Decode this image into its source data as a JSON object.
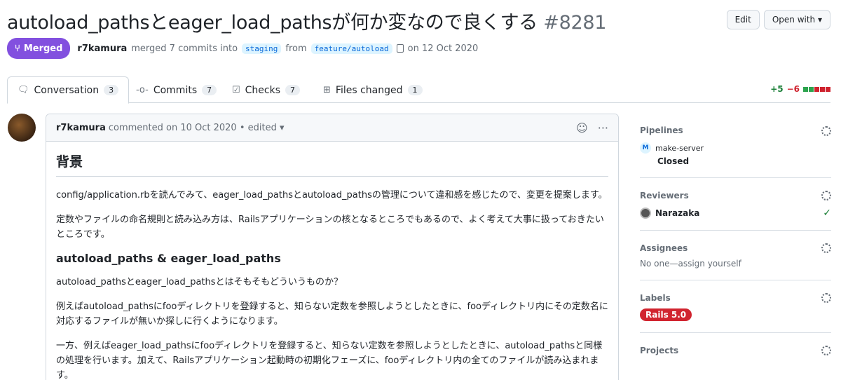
{
  "header": {
    "title": "autoload_pathsとeager_load_pathsが何か変なので良くする",
    "number": "#8281",
    "edit_label": "Edit",
    "open_with_label": "Open with ▾"
  },
  "meta": {
    "state": "Merged",
    "author": "r7kamura",
    "merged_text": "merged 7 commits into",
    "base_branch": "staging",
    "from_text": "from",
    "head_branch": "feature/autoload",
    "date_text": "on 12 Oct 2020"
  },
  "tabs": [
    {
      "label": "Conversation",
      "count": "3"
    },
    {
      "label": "Commits",
      "count": "7"
    },
    {
      "label": "Checks",
      "count": "7"
    },
    {
      "label": "Files changed",
      "count": "1"
    }
  ],
  "diffstat": {
    "additions": "+5",
    "deletions": "−6",
    "blocks": [
      "#2da44e",
      "#2da44e",
      "#cf222e",
      "#cf222e",
      "#cf222e"
    ]
  },
  "comment": {
    "author": "r7kamura",
    "meta": "commented on 10 Oct 2020 • edited ▾",
    "heading1": "背景",
    "p1": "config/application.rbを読んでみて、eager_load_pathsとautoload_pathsの管理について違和感を感じたので、変更を提案します。",
    "p2": "定数やファイルの命名規則と読み込み方は、Railsアプリケーションの核となるところでもあるので、よく考えて大事に扱っておきたいところです。",
    "heading2": "autoload_paths & eager_load_paths",
    "p3": "autoload_pathsとeager_load_pathsとはそもそもどういうものか？",
    "p4": "例えばautoload_pathsにfooディレクトリを登録すると、知らない定数を参照しようとしたときに、fooディレクトリ内にその定数名に対応するファイルが無いか探しに行くようになります。",
    "p5": "一方、例えばeager_load_pathsにfooディレクトリを登録すると、知らない定数を参照しようとしたときに、autoload_pathsと同様の処理を行います。加えて、Railsアプリケーション起動時の初期化フェーズに、fooディレクトリ内の全てのファイルが読み込まれます。"
  },
  "sidebar": {
    "pipelines": {
      "title": "Pipelines",
      "badge": "M",
      "name": "make-server",
      "status": "Closed"
    },
    "reviewers": {
      "title": "Reviewers",
      "name": "Narazaka"
    },
    "assignees": {
      "title": "Assignees",
      "text": "No one—assign yourself"
    },
    "labels": {
      "title": "Labels",
      "label": "Rails 5.0"
    },
    "projects": {
      "title": "Projects"
    }
  }
}
